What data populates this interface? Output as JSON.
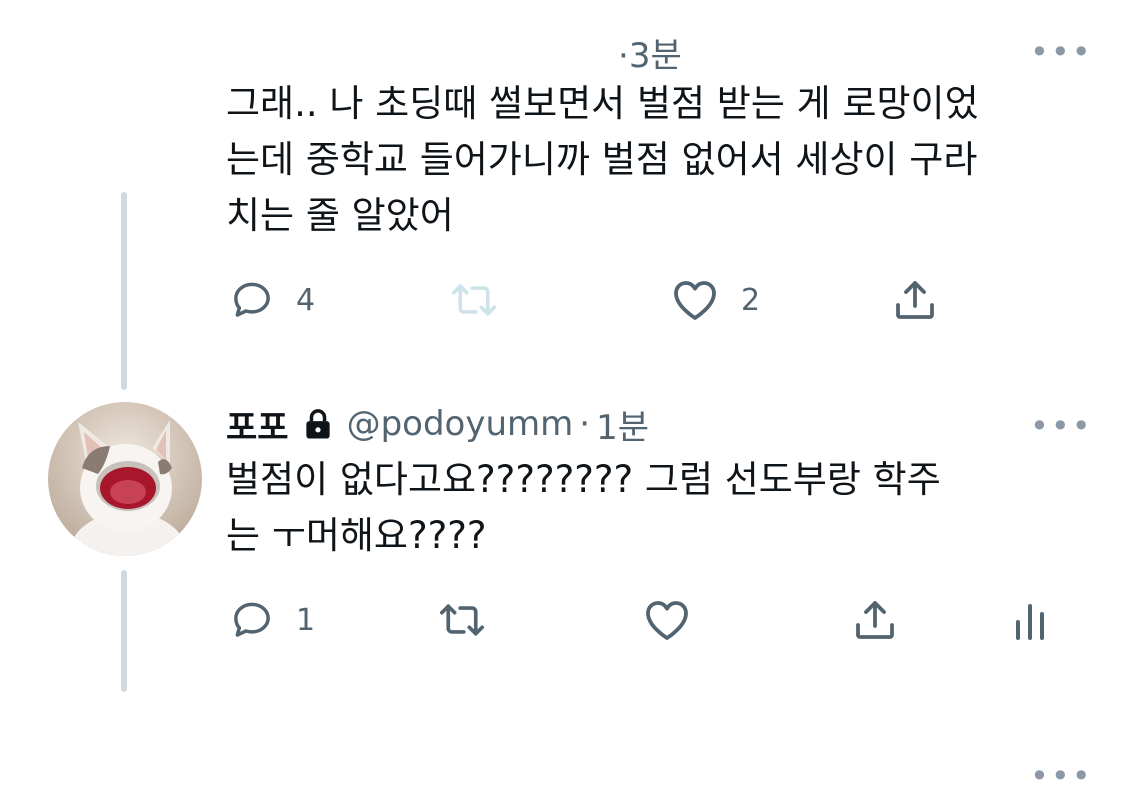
{
  "tweet1": {
    "time_prefix": "·",
    "time": "3분",
    "more": "•••",
    "text_lines": [
      "그래.. 나 초딩때 썰보면서 벌점 받는 게 로망이었",
      "는데 중학교 들어가니까 벌점 없어서 세상이 구라",
      "치는 줄 알았어"
    ],
    "actions": {
      "reply_count": "4",
      "retweet_count": "",
      "like_count": "2"
    }
  },
  "tweet2": {
    "name": "포포",
    "handle": "@podoyumm",
    "dot": "·",
    "time": "1분",
    "more": "•••",
    "text_lines": [
      "벌점이 없다고요???????? 그럼 선도부랑 학주",
      "는 ㅜ머해요????"
    ],
    "actions": {
      "reply_count": "1",
      "retweet_count": "",
      "like_count": ""
    }
  },
  "footer": {
    "more": "•••"
  },
  "icons": {
    "reply": "reply-icon",
    "retweet": "retweet-icon",
    "like": "heart-icon",
    "share": "share-icon",
    "analytics": "analytics-icon",
    "lock": "lock-icon"
  },
  "colors": {
    "text": "#0f1419",
    "secondary": "#536471",
    "thread_line": "#cfd9de",
    "retweet_disabled": "#cfe3ea"
  }
}
